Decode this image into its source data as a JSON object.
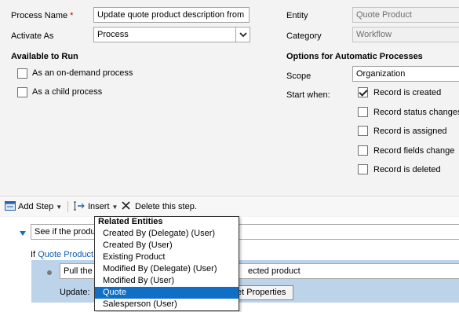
{
  "form": {
    "process_name_label": "Process Name",
    "required_mark": "*",
    "process_name_value": "Update quote product description from",
    "activate_as_label": "Activate As",
    "activate_as_value": "Process",
    "entity_label": "Entity",
    "entity_value": "Quote Product",
    "category_label": "Category",
    "category_value": "Workflow"
  },
  "available_to_run": {
    "title": "Available to Run",
    "options": [
      {
        "label": "As an on-demand process",
        "checked": false
      },
      {
        "label": "As a child process",
        "checked": false
      }
    ]
  },
  "automatic": {
    "title": "Options for Automatic Processes",
    "scope_label": "Scope",
    "scope_value": "Organization",
    "start_when_label": "Start when:",
    "options": [
      {
        "label": "Record is created",
        "checked": true
      },
      {
        "label": "Record status changes",
        "checked": false
      },
      {
        "label": "Record is assigned",
        "checked": false
      },
      {
        "label": "Record fields change",
        "checked": false
      },
      {
        "label": "Record is deleted",
        "checked": false
      }
    ]
  },
  "toolbar": {
    "add_step": "Add Step",
    "insert": "Insert",
    "delete": "Delete this step."
  },
  "steps": {
    "step1_text": "See if the produ",
    "if_prefix": "If",
    "if_link": "Quote Product",
    "step2_text_start": "Pull the",
    "step2_text_end": "ected product",
    "update_label": "Update:",
    "set_properties": "et Properties"
  },
  "menu": {
    "header": "Related Entities",
    "items": [
      {
        "label": "Created By (Delegate) (User)",
        "highlighted": false
      },
      {
        "label": "Created By (User)",
        "highlighted": false
      },
      {
        "label": "Existing Product",
        "highlighted": false
      },
      {
        "label": "Modified By (Delegate) (User)",
        "highlighted": false
      },
      {
        "label": "Modified By (User)",
        "highlighted": false
      },
      {
        "label": "Quote",
        "highlighted": true
      },
      {
        "label": "Salesperson (User)",
        "highlighted": false
      }
    ]
  },
  "colors": {
    "accent": "#0f6fc6",
    "required": "#c00000",
    "link": "#0b5cad",
    "step_band": "#bcd3ea"
  }
}
